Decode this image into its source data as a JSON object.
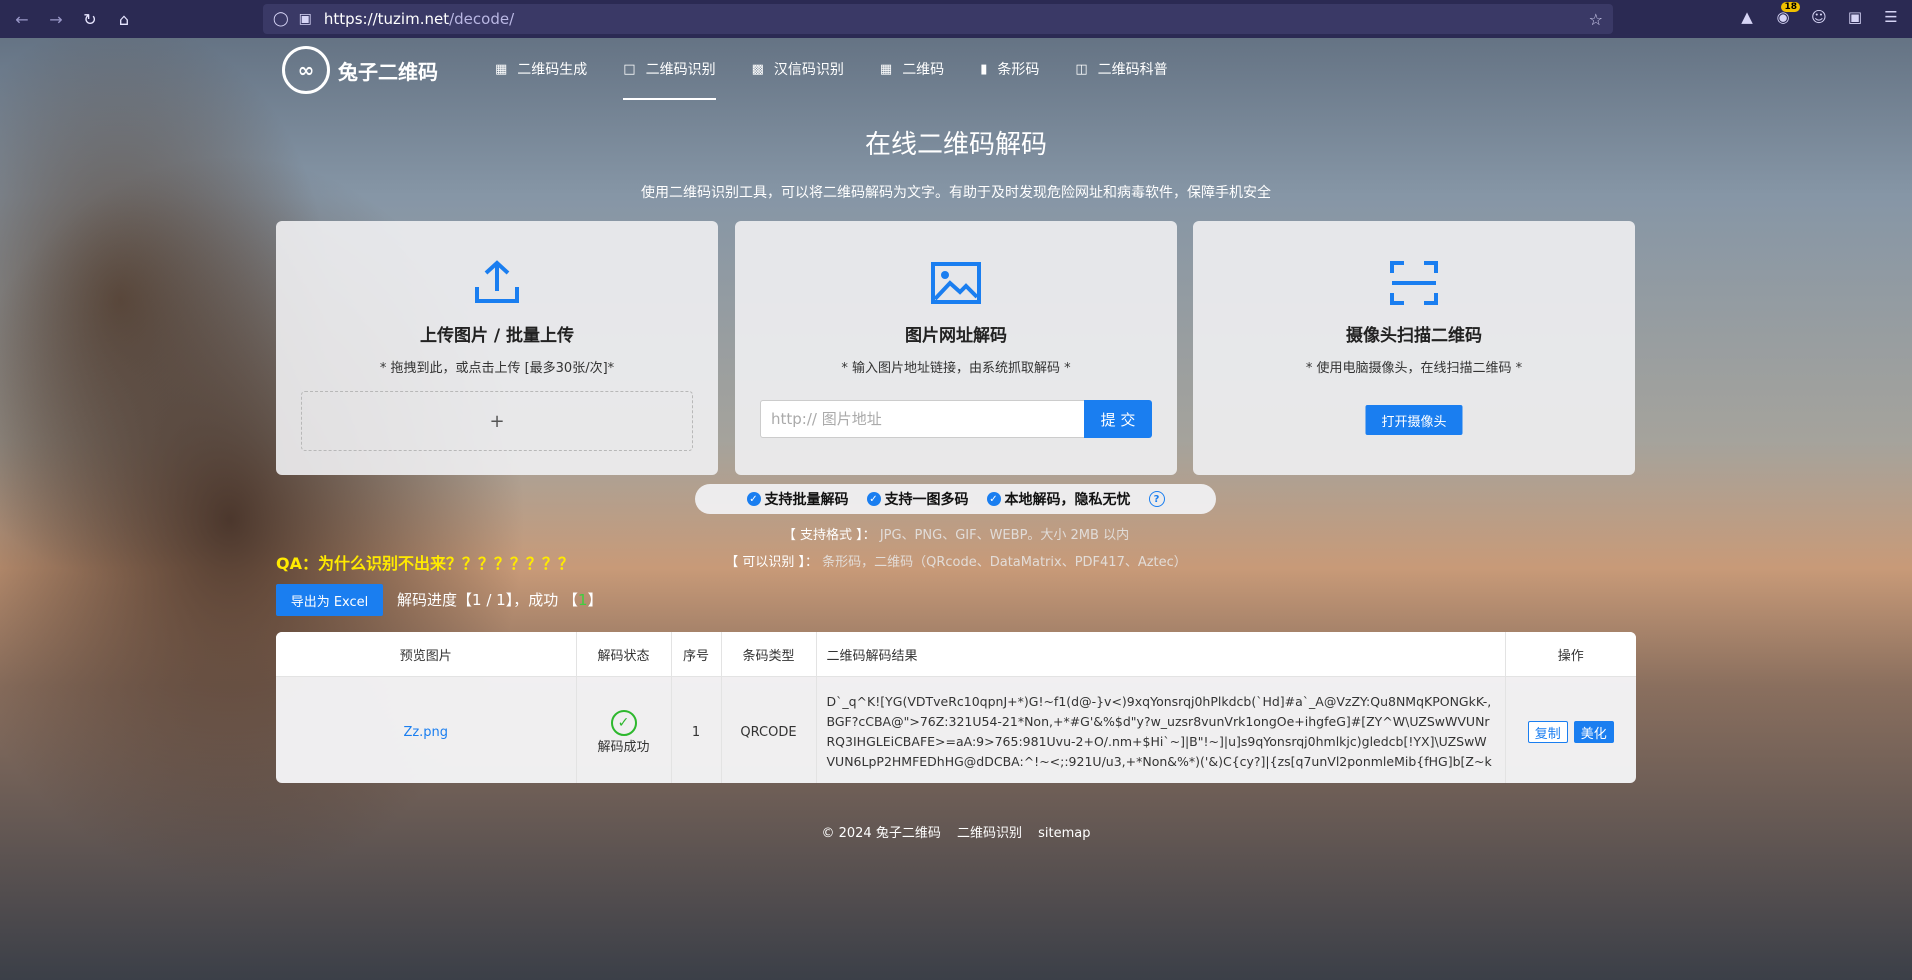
{
  "browser": {
    "url_host": "https://tuzim.net",
    "url_path": "/decode/",
    "badge_count": "18"
  },
  "site": {
    "logo_text": "兔子二维码",
    "menu": [
      {
        "label": "二维码生成",
        "icon": "qrcode-grid-icon"
      },
      {
        "label": "二维码识别",
        "icon": "scan-icon",
        "active": true
      },
      {
        "label": "汉信码识别",
        "icon": "terminal-icon"
      },
      {
        "label": "二维码",
        "icon": "grid-icon"
      },
      {
        "label": "条形码",
        "icon": "barcode-icon"
      },
      {
        "label": "二维码科普",
        "icon": "book-icon"
      }
    ]
  },
  "page": {
    "title": "在线二维码解码",
    "subtitle": "使用二维码识别工具，可以将二维码解码为文字。有助于及时发现危险网址和病毒软件，保障手机安全"
  },
  "cards": {
    "upload": {
      "title": "上传图片 / 批量上传",
      "desc": "* 拖拽到此，或点击上传 [最多30张/次]*",
      "dropzone": "+"
    },
    "url": {
      "title": "图片网址解码",
      "desc": "* 输入图片地址链接，由系统抓取解码 *",
      "placeholder": "http:// 图片地址",
      "submit": "提 交"
    },
    "camera": {
      "title": "摄像头扫描二维码",
      "desc": "* 使用电脑摄像头，在线扫描二维码 *",
      "button": "打开摄像头"
    }
  },
  "features": [
    "支持批量解码",
    "支持一图多码",
    "本地解码，隐私无忧"
  ],
  "formats": {
    "label": "【 支持格式 】：",
    "value": "JPG、PNG、GIF、WEBP。大小 2MB 以内"
  },
  "recognize": {
    "label": "【 可以识别 】：",
    "value": "条形码，二维码（QRcode、DataMatrix、PDF417、Aztec）"
  },
  "qa": "QA：为什么识别不出来？？？？？？？？",
  "export_label": "导出为 Excel",
  "progress": {
    "prefix": "解码进度【",
    "done": "1 / 1",
    "mid": "】，成功 【",
    "success": "1",
    "suffix": "】"
  },
  "table": {
    "headers": [
      "预览图片",
      "解码状态",
      "序号",
      "条码类型",
      "二维码解码结果",
      "操作"
    ],
    "rows": [
      {
        "file": "Zz.png",
        "status": "解码成功",
        "index": "1",
        "type": "QRCODE",
        "result": "D`_q^K![YG(VDTveRc10qpnJ+*)G!~f1(d@-}v<)9xqYonsrqj0hPlkdcb(`Hd]#a`_A@VzZY:Qu8NMqKPONGkK-,BGF?cCBA@\">76Z:321U54-21*Non,+*#G'&%$d\"y?w_uzsr8vunVrk1ongOe+ihgfeG]#[ZY^W\\UZSwWVUNrRQ3IHGLEiCBAFE>=aA:9>765:981Uvu-2+O/.nm+$Hi`~]|B\"!~]|u]s9qYonsrqj0hmlkjc)gledcb[!YX]\\UZSwWVUN6LpP2HMFEDhHG@dDCBA:^!~<;:921U/u3,+*Non&%*)('&)C{cy?]|{zs[q7unVl2ponmleMib{fHG]b[Z~k",
        "copy": "复制",
        "beautify": "美化"
      }
    ]
  },
  "footer": [
    "© 2024 兔子二维码",
    "二维码识别",
    "sitemap"
  ],
  "colors": {
    "accent": "#1a7ef0",
    "chrome": "#2b2a53",
    "qa": "#ffea00",
    "success": "#2eb82e"
  }
}
